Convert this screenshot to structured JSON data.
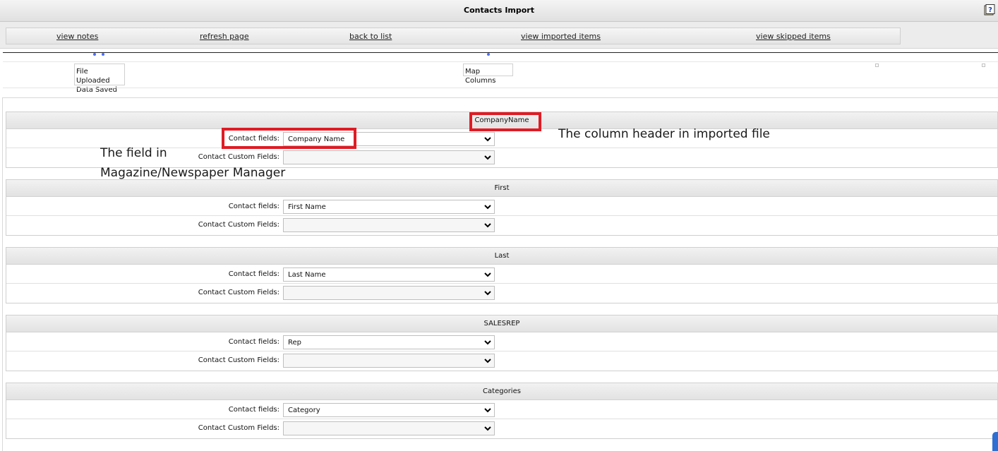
{
  "window": {
    "title": "Contacts Import",
    "help_icon": "help-question-icon"
  },
  "nav": {
    "links": [
      "view notes",
      "refresh page",
      "back to list",
      "view imported items",
      "view skipped items"
    ]
  },
  "progress": {
    "stages": [
      {
        "lines": [
          "File Uploaded",
          "Data Saved"
        ]
      },
      {
        "lines": [
          "Map Columns"
        ]
      }
    ]
  },
  "mapping": {
    "contact_fields_label": "Contact fields:",
    "custom_fields_label": "Contact Custom Fields:",
    "sections": [
      {
        "column_header": "CompanyName",
        "contact_field": "Company Name",
        "custom_field": ""
      },
      {
        "column_header": "First",
        "contact_field": "First Name",
        "custom_field": ""
      },
      {
        "column_header": "Last",
        "contact_field": "Last Name",
        "custom_field": ""
      },
      {
        "column_header": "SALESREP",
        "contact_field": "Rep",
        "custom_field": ""
      },
      {
        "column_header": "Categories",
        "contact_field": "Category",
        "custom_field": ""
      }
    ]
  },
  "annotations": {
    "column_header_note": "The column header in imported file",
    "field_note_line1": "The field in",
    "field_note_line2": "Magazine/Newspaper Manager",
    "highlight_color": "#e01b24"
  }
}
